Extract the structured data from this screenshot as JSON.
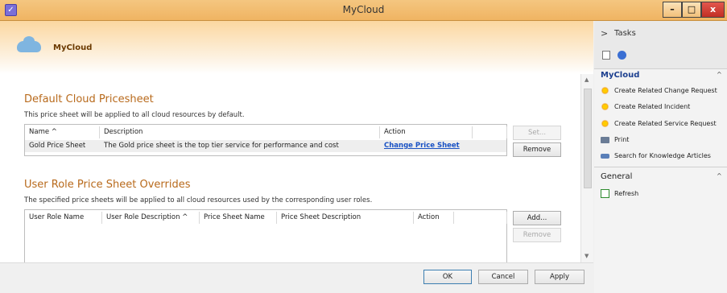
{
  "window": {
    "title": "MyCloud",
    "min": "–",
    "max": "□",
    "close": "x"
  },
  "header": {
    "title": "MyCloud"
  },
  "default_section": {
    "title": "Default Cloud Pricesheet",
    "description": "This price sheet will be applied to all cloud resources by default.",
    "columns": [
      "Name ^",
      "Description",
      "Action"
    ],
    "rows": [
      {
        "name": "Gold Price Sheet",
        "description": "The Gold price sheet is the top tier service for performance and cost",
        "action": "Change Price Sheet"
      }
    ],
    "buttons": {
      "set": "Set...",
      "remove": "Remove"
    }
  },
  "override_section": {
    "title": "User Role Price Sheet Overrides",
    "description": "The specified price sheets will be applied to all cloud resources used by the corresponding user roles.",
    "columns": [
      "User Role Name",
      "User Role Description ^",
      "Price Sheet Name",
      "Price Sheet Description",
      "Action"
    ],
    "buttons": {
      "add": "Add...",
      "remove": "Remove"
    }
  },
  "footer": {
    "ok": "OK",
    "cancel": "Cancel",
    "apply": "Apply"
  },
  "task_pane": {
    "header": "Tasks",
    "groups": [
      {
        "title": "MyCloud",
        "items": [
          {
            "label": "Create Related Change Request",
            "icon": "sun-icon"
          },
          {
            "label": "Create Related Incident",
            "icon": "sun-icon"
          },
          {
            "label": "Create Related Service Request",
            "icon": "sun-icon"
          },
          {
            "label": "Print",
            "icon": "printer-icon"
          },
          {
            "label": "Search for Knowledge Articles",
            "icon": "search-icon"
          }
        ]
      },
      {
        "title": "General",
        "items": [
          {
            "label": "Refresh",
            "icon": "refresh-icon"
          }
        ]
      }
    ]
  },
  "colors": {
    "accent": "#b86a1c",
    "link": "#1a52c4",
    "titlebar": "#f0b462"
  }
}
